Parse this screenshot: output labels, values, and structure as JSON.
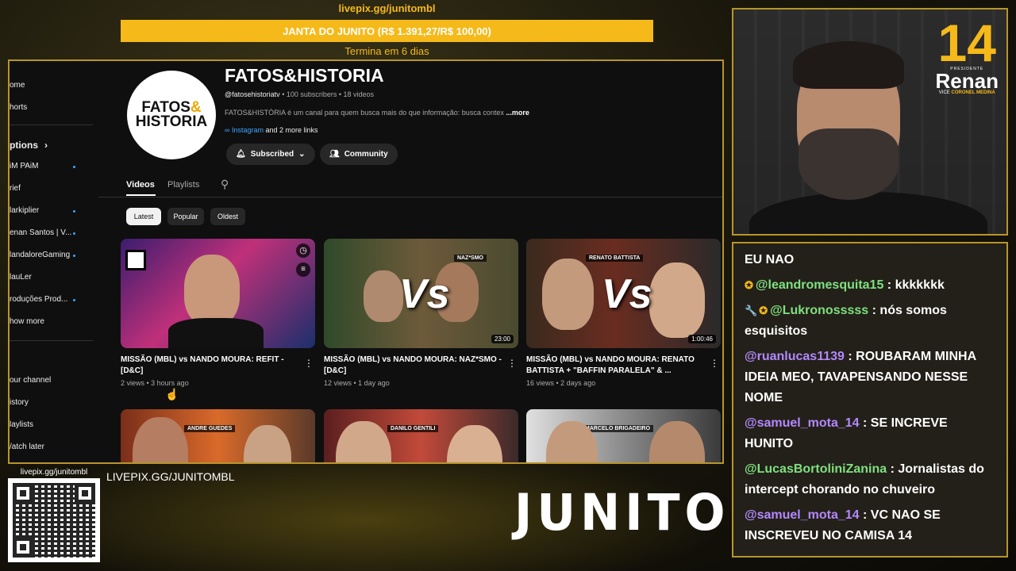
{
  "overlay": {
    "top_link": "livepix.gg/junitombl",
    "goal_text": "JANTA DO JUNITO (R$ 1.391,27/R$ 100,00)",
    "goal_sub": "Termina em 6 dias",
    "qr_label": "livepix.gg/junitombl",
    "livepix_text": "LIVEPIX.GG/JUNITOMBL",
    "brand": "JUNITO",
    "colors": {
      "accent": "#f5b91a",
      "frame": "#b7952a"
    }
  },
  "sidebar": {
    "items": [
      {
        "label": "ome"
      },
      {
        "label": "horts"
      },
      {
        "label": "ptions"
      },
      {
        "label": "iM PAiM"
      },
      {
        "label": "rief"
      },
      {
        "label": "larkiplier"
      },
      {
        "label": "enan Santos | V..."
      },
      {
        "label": "landaloreGaming"
      },
      {
        "label": "lauLer"
      },
      {
        "label": "roduções Prod..."
      },
      {
        "label": "how more"
      },
      {
        "label": "our channel"
      },
      {
        "label": "istory"
      },
      {
        "label": "laylists"
      },
      {
        "label": "/atch later"
      }
    ]
  },
  "channel": {
    "avatar_line1": "FATOS",
    "avatar_amp": "&",
    "avatar_line2": "HISTORIA",
    "name": "FATOS&HISTORIA",
    "handle": "@fatosehistoriatv",
    "stats": "• 100 subscribers • 18 videos",
    "description": "FATOS&HISTÓRIA é um canal para quem busca mais do que informação: busca contex",
    "more": "...more",
    "link_instagram": "Instagram",
    "link_more": "and 2 more links",
    "subscribed_label": "Subscribed",
    "community_label": "Community"
  },
  "tabs": [
    {
      "label": "Videos"
    },
    {
      "label": "Playlists"
    }
  ],
  "chips": [
    {
      "label": "Latest"
    },
    {
      "label": "Popular"
    },
    {
      "label": "Oldest"
    }
  ],
  "videos": [
    {
      "title": "MISSÃO (MBL) vs NANDO MOURA: REFIT - [D&C]",
      "meta": "2 views • 3 hours ago",
      "duration": ""
    },
    {
      "title": "MISSÃO (MBL) vs NANDO MOURA: NAZ*SMO - [D&C]",
      "meta": "12 views • 1 day ago",
      "duration": "23:00",
      "tag": "NAZ*SMO"
    },
    {
      "title": "MISSÃO (MBL) vs NANDO MOURA: RENATO BATTISTA + \"BAFFIN PARALELA\" & ...",
      "meta": "16 views • 2 days ago",
      "duration": "1:00:46",
      "tag": "RENATO BATTISTA"
    },
    {
      "tag": "ANDRE GUEDES"
    },
    {
      "tag": "DANILO GENTILI"
    },
    {
      "tag": "MARCELO BRIGADEIRO"
    }
  ],
  "webcam": {
    "logo_number": "14",
    "logo_pres": "PRESIDENTE",
    "logo_name": "Renan",
    "logo_vice_prefix": "VICE",
    "logo_vice": "CORONEL MEDINA"
  },
  "chat": {
    "messages": [
      {
        "user": "",
        "text": "EU NAO"
      },
      {
        "user": "@leandromesquita15",
        "text": ": kkkkkkk",
        "badge": "✪"
      },
      {
        "user": "@Lukronosssss",
        "text": ": nós somos esquisitos",
        "badge": "✪",
        "wrench": "🔧"
      },
      {
        "user": "@ruanlucas1139",
        "text": ": ROUBARAM MINHA IDEIA MEO, TAVAPENSANDO NESSE NOME"
      },
      {
        "user": "@samuel_mota_14",
        "text": ": SE INCREVE HUNITO"
      },
      {
        "user": "@LucasBortoliniZanina",
        "text": ": Jornalistas do intercept chorando no chuveiro",
        "green": true
      },
      {
        "user": "@samuel_mota_14",
        "text": ": VC NAO SE INSCREVEU NO CAMISA 14"
      }
    ]
  }
}
